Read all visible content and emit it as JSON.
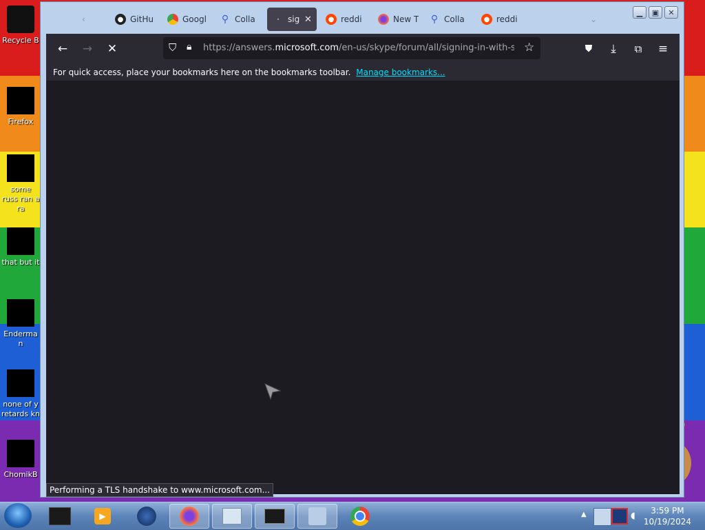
{
  "desktop": {
    "icons": [
      {
        "label": "Recycle B"
      },
      {
        "label": "Firefox"
      },
      {
        "label": "some russ ran a ra"
      },
      {
        "label": "that but it"
      },
      {
        "label": "Enderman"
      },
      {
        "label": "none of y retards kn"
      },
      {
        "label": "ChomikB"
      }
    ]
  },
  "browser": {
    "tabs": [
      {
        "label": "GitHu",
        "icon": "github-icon"
      },
      {
        "label": "Googl",
        "icon": "chrome-icon"
      },
      {
        "label": "Colla",
        "icon": "search-icon"
      },
      {
        "label": "sig",
        "icon": "loading-icon",
        "active": true
      },
      {
        "label": "reddi",
        "icon": "reddit-icon"
      },
      {
        "label": "New T",
        "icon": "firefox-icon"
      },
      {
        "label": "Colla",
        "icon": "search-icon"
      },
      {
        "label": "reddi",
        "icon": "reddit-icon"
      }
    ],
    "url": {
      "prefix": "https://answers.",
      "domain": "microsoft.com",
      "suffix": "/en-us/skype/forum/all/signing-in-with-skyp"
    },
    "bookmarks_bar": {
      "text": "For quick access, place your bookmarks here on the bookmarks toolbar.",
      "link": "Manage bookmarks..."
    },
    "status": "Performing a TLS handshake to www.microsoft.com..."
  },
  "taskbar": {
    "time": "3:59 PM",
    "date": "10/19/2024"
  },
  "colors": {
    "toolbar": "#2b2a33",
    "content": "#1c1b22",
    "link": "#00ddff"
  }
}
